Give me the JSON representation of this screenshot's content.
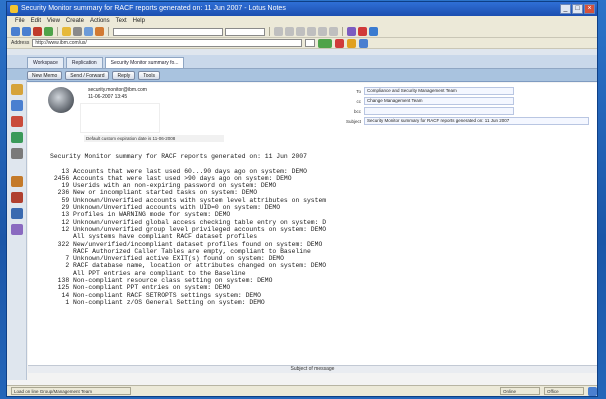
{
  "window": {
    "title": "Security Monitor summary for RACF reports generated on: 11 Jun 2007 - Lotus Notes",
    "controls": [
      "_",
      "□",
      "×"
    ]
  },
  "menu": [
    "File",
    "Edit",
    "View",
    "Create",
    "Actions",
    "Text",
    "Help"
  ],
  "address": {
    "label": "Address",
    "value": "http://www.ibm.com/us/"
  },
  "tabs": [
    {
      "label": "Workspace"
    },
    {
      "label": "Replication"
    },
    {
      "label": "Security Monitor summary fo..."
    }
  ],
  "actions": [
    "New Memo",
    "Send / Forward",
    "Reply",
    "Tools"
  ],
  "message": {
    "from": "security.monitor@ibm.com",
    "date": "11-06-2007 13:45",
    "expire_note": "Default custom expiration date is 11-06-2008",
    "fields": [
      {
        "label": "To",
        "value": "Compliance and Security Management Team"
      },
      {
        "label": "cc",
        "value": "Change Management Team"
      },
      {
        "label": "bcc",
        "value": ""
      },
      {
        "label": "Subject",
        "value": "Security Monitor summary for RACF reports generated on: 11 Jun 2007"
      }
    ],
    "body_title": "Security Monitor summary for RACF reports generated on: 11 Jun 2007",
    "body_lines": [
      "   13 Accounts that were last used 60...90 days ago on system: DEMO",
      " 2456 Accounts that were last used >90 days ago on system: DEMO",
      "   19 Userids with an non-expiring password on system: DEMO",
      "  236 New or incompliant started tasks on system: DEMO",
      "   59 Unknown/Unverified accounts with system level attributes on system",
      "   29 Unknown/Unverified accounts with UID=0 on system: DEMO",
      "   13 Profiles in WARNING mode for system: DEMO",
      "   12 Unknown/unverified global access checking table entry on system: D",
      "   12 Unknown/unverified group level privileged accounts on system: DEMO",
      "      All systems have compliant RACF dataset profiles",
      "  322 New/unverified/incompliant dataset profiles found on system: DEMO",
      "      RACF Authorized Caller Tables are empty, compliant to Baseline",
      "    7 Unknown/Unverified active EXIT(s) found on system: DEMO",
      "    2 RACF database name, location or attributes changed on system: DEMO",
      "      All PPT entries are compliant to the Baseline",
      "  138 Non-compliant resource class setting on system: DEMO",
      "  125 Non-compliant PPT entries on system: DEMO",
      "   14 Non-compliant RACF SETROPTS settings system: DEMO",
      "    1 Non-compliant z/OS General Setting on system: DEMO"
    ],
    "subject_bar": "Subject of message"
  },
  "status": [
    "Load on line Group/Management Team",
    "Online",
    "Office"
  ]
}
